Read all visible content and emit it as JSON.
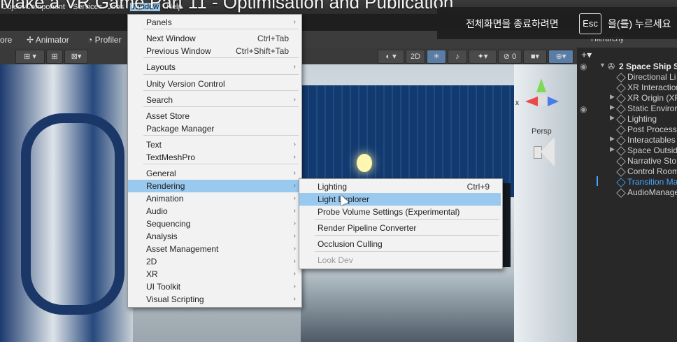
{
  "video": {
    "title": "Make a VR Game Part 11 - Optimisation and Publication"
  },
  "menubar": {
    "items": [
      "Object",
      "Component",
      "Services",
      "Jobs",
      "Window",
      "Help"
    ]
  },
  "tabs": {
    "left": "ore",
    "animator": "Animator",
    "profiler": "Profiler"
  },
  "toolbar": {
    "two_d": "2D"
  },
  "scene": {
    "persp_label": "Persp",
    "gizmo_x": "x"
  },
  "esc_overlay": {
    "before": "전체화면을 종료하려면",
    "key": "Esc",
    "after": "을(를) 누르세요"
  },
  "hierarchy": {
    "title": "Hierarchy",
    "scene_name": "2 Space Ship S",
    "items": [
      {
        "label": "Directional Li",
        "arrow": ""
      },
      {
        "label": "XR Interaction",
        "arrow": ""
      },
      {
        "label": "XR Origin (XR",
        "arrow": "▶"
      },
      {
        "label": "Static Enviror",
        "arrow": "▶"
      },
      {
        "label": "Lighting",
        "arrow": "▶"
      },
      {
        "label": "Post Process",
        "arrow": ""
      },
      {
        "label": "Interactables",
        "arrow": "▶"
      },
      {
        "label": "Space Outsid",
        "arrow": "▶"
      },
      {
        "label": "Narrative Sto",
        "arrow": ""
      },
      {
        "label": "Control Room",
        "arrow": ""
      },
      {
        "label": "Transition Ma",
        "arrow": ""
      },
      {
        "label": "AudioManage",
        "arrow": ""
      }
    ]
  },
  "window_menu": {
    "items": [
      {
        "label": "Panels",
        "shortcut": "",
        "submenu": true
      },
      {
        "label": "Next Window",
        "shortcut": "Ctrl+Tab",
        "submenu": false
      },
      {
        "label": "Previous Window",
        "shortcut": "Ctrl+Shift+Tab",
        "submenu": false
      },
      {
        "label": "Layouts",
        "shortcut": "",
        "submenu": true
      },
      {
        "label": "Unity Version Control",
        "shortcut": "",
        "submenu": false
      },
      {
        "label": "Search",
        "shortcut": "",
        "submenu": true
      },
      {
        "label": "Asset Store",
        "shortcut": "",
        "submenu": false
      },
      {
        "label": "Package Manager",
        "shortcut": "",
        "submenu": false
      },
      {
        "label": "Text",
        "shortcut": "",
        "submenu": true
      },
      {
        "label": "TextMeshPro",
        "shortcut": "",
        "submenu": true
      },
      {
        "label": "General",
        "shortcut": "",
        "submenu": true
      },
      {
        "label": "Rendering",
        "shortcut": "",
        "submenu": true
      },
      {
        "label": "Animation",
        "shortcut": "",
        "submenu": true
      },
      {
        "label": "Audio",
        "shortcut": "",
        "submenu": true
      },
      {
        "label": "Sequencing",
        "shortcut": "",
        "submenu": true
      },
      {
        "label": "Analysis",
        "shortcut": "",
        "submenu": true
      },
      {
        "label": "Asset Management",
        "shortcut": "",
        "submenu": true
      },
      {
        "label": "2D",
        "shortcut": "",
        "submenu": true
      },
      {
        "label": "XR",
        "shortcut": "",
        "submenu": true
      },
      {
        "label": "UI Toolkit",
        "shortcut": "",
        "submenu": true
      },
      {
        "label": "Visual Scripting",
        "shortcut": "",
        "submenu": true
      }
    ]
  },
  "rendering_menu": {
    "items": [
      {
        "label": "Lighting",
        "shortcut": "Ctrl+9"
      },
      {
        "label": "Light Explorer",
        "shortcut": ""
      },
      {
        "label": "Probe Volume Settings (Experimental)",
        "shortcut": ""
      },
      {
        "label": "Render Pipeline Converter",
        "shortcut": ""
      },
      {
        "label": "Occlusion Culling",
        "shortcut": ""
      },
      {
        "label": "Look Dev",
        "shortcut": ""
      }
    ]
  },
  "colors": {
    "highlight": "#99c9ef",
    "menu_bg": "#f2f2f2",
    "selected_hierarchy": "#4aa3ff"
  }
}
